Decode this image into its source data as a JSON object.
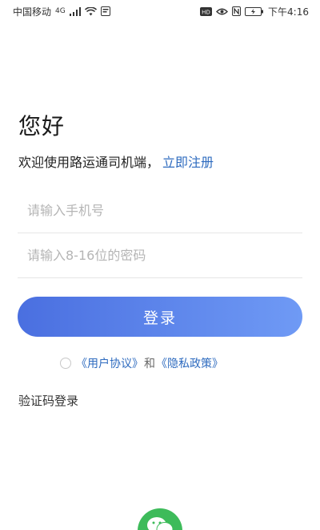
{
  "status_bar": {
    "carrier": "中国移动",
    "network": "4G",
    "time": "下午4:16",
    "icons": [
      "signal-icon",
      "wifi-icon",
      "notification-icon",
      "hd-icon",
      "eye-icon",
      "nfc-icon",
      "battery-icon"
    ]
  },
  "greeting": "您好",
  "welcome": {
    "text": "欢迎使用路运通司机端，",
    "register_link": "立即注册"
  },
  "form": {
    "phone_placeholder": "请输入手机号",
    "password_placeholder": "请输入8-16位的密码"
  },
  "login_button": "登录",
  "agreement": {
    "user_agreement": "《用户协议》",
    "and": "和",
    "privacy_policy": "《隐私政策》"
  },
  "sms_login": "验证码登录",
  "colors": {
    "accent": "#2e6bbf",
    "button_gradient_start": "#4a6fe0",
    "button_gradient_end": "#6f9af5",
    "wechat_green": "#3dbb5a"
  }
}
